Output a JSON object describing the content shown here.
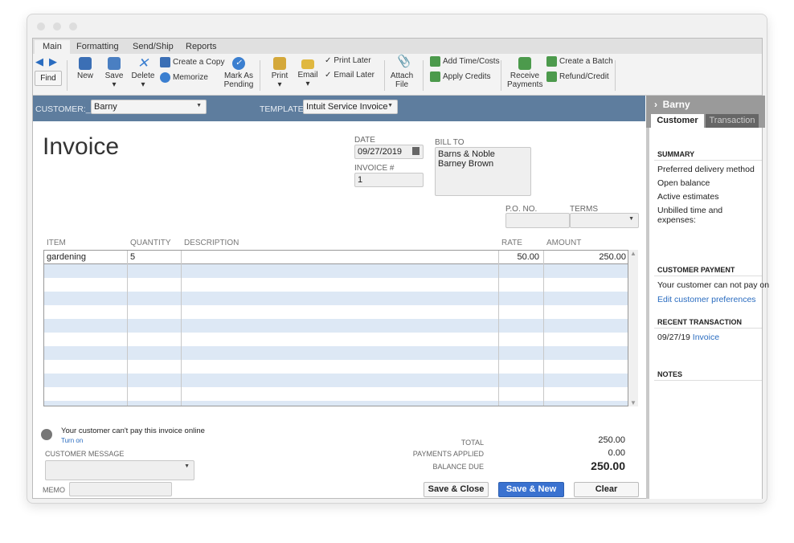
{
  "ribbon_tabs": [
    "Main",
    "Formatting",
    "Send/Ship",
    "Reports"
  ],
  "toolbar": {
    "find": "Find",
    "new": "New",
    "save": "Save",
    "delete": "Delete",
    "create_copy": "Create a Copy",
    "memorize": "Memorize",
    "mark_pending": [
      "Mark As",
      "Pending"
    ],
    "print": "Print",
    "email": "Email",
    "print_later": "Print Later",
    "email_later": "Email Later",
    "attach": [
      "Attach",
      "File"
    ],
    "add_time": "Add Time/Costs",
    "apply_credits": "Apply Credits",
    "receive": [
      "Receive",
      "Payments"
    ],
    "create_batch": "Create a Batch",
    "refund": "Refund/Credit"
  },
  "header": {
    "customer_label": "CUSTOMER:_",
    "customer": "Barny",
    "template_label": "TEMPLATE",
    "template": "Intuit Service Invoice"
  },
  "form": {
    "title": "Invoice",
    "date_label": "DATE",
    "date": "09/27/2019",
    "invoice_label": "INVOICE #",
    "invoice_no": "1",
    "bill_to_label": "BILL TO",
    "bill_to": [
      "Barns & Noble",
      "Barney Brown"
    ],
    "po_label": "P.O. NO.",
    "terms_label": "TERMS"
  },
  "table": {
    "columns": [
      "ITEM",
      "QUANTITY",
      "DESCRIPTION",
      "RATE",
      "AMOUNT"
    ],
    "rows": [
      {
        "item": "gardening",
        "quantity": "5",
        "description": "",
        "rate": "50.00",
        "amount": "250.00"
      }
    ]
  },
  "footer": {
    "online_msg": "Your customer can't pay this invoice online",
    "turn_on": "Turn on",
    "customer_message_label": "CUSTOMER MESSAGE",
    "memo_label": "MEMO",
    "total_label": "TOTAL",
    "total": "250.00",
    "payments_label": "PAYMENTS APPLIED",
    "payments": "0.00",
    "balance_label": "BALANCE DUE",
    "balance": "250.00",
    "save_close": "Save & Close",
    "save_new": "Save & New",
    "clear": "Clear"
  },
  "sidebar": {
    "name": "Barny",
    "tabs": [
      "Customer",
      "Transaction"
    ],
    "summary": "SUMMARY",
    "summary_items": [
      "Preferred delivery method",
      "Open balance",
      "Active estimates",
      "Unbilled time and expenses:"
    ],
    "payment_head": "CUSTOMER PAYMENT",
    "payment_text": "Your customer can not pay on",
    "edit_prefs": "Edit customer preferences",
    "recent_head": "RECENT TRANSACTION",
    "recent_date": "09/27/19",
    "recent_link": "Invoice",
    "notes_head": "NOTES"
  },
  "colors": {
    "bar": "#5e7d9e",
    "accent": "#3a72d0"
  }
}
